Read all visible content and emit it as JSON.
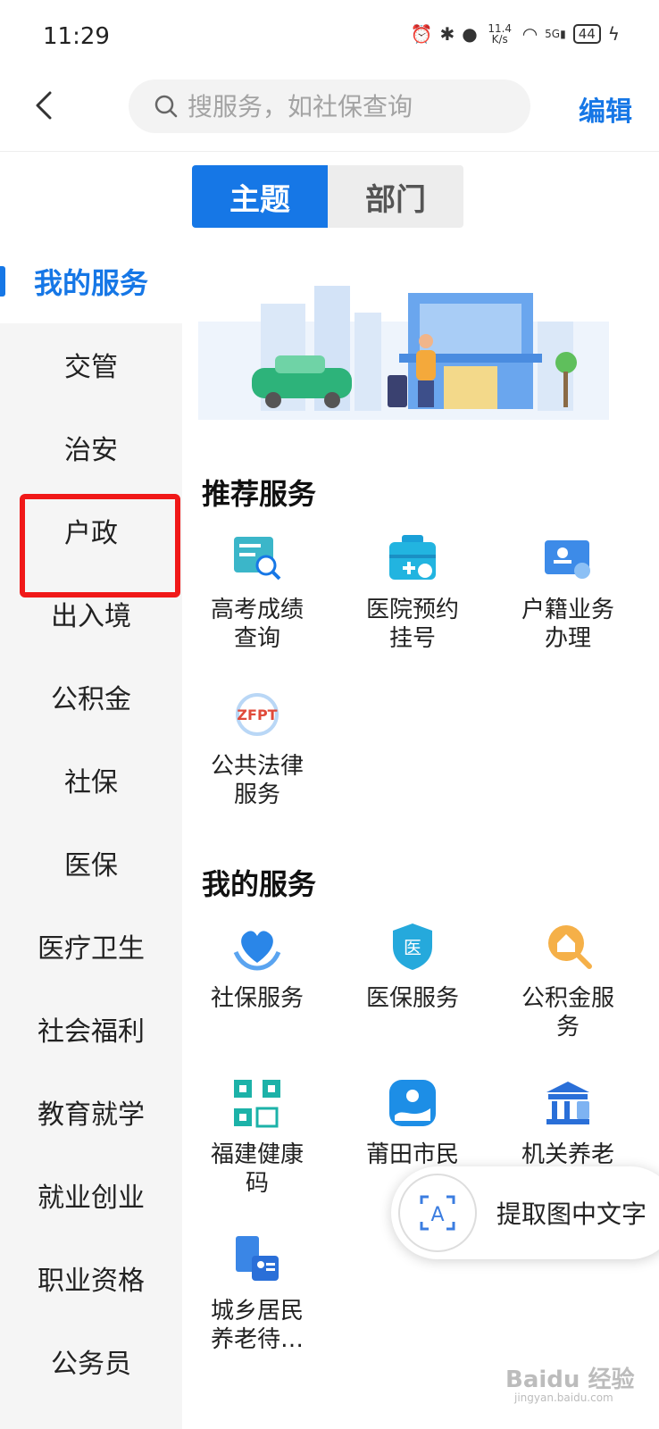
{
  "status_bar": {
    "time": "11:29",
    "net_speed_value": "11.4",
    "net_speed_unit": "K/s",
    "signal_label": "5G",
    "battery": "44"
  },
  "header": {
    "search_placeholder": "搜服务，如社保查询",
    "edit_label": "编辑"
  },
  "tabs": [
    {
      "label": "主题",
      "active": true
    },
    {
      "label": "部门",
      "active": false
    }
  ],
  "sidebar": {
    "items": [
      {
        "label": "我的服务",
        "active": true
      },
      {
        "label": "交管"
      },
      {
        "label": "治安"
      },
      {
        "label": "户政"
      },
      {
        "label": "出入境"
      },
      {
        "label": "公积金"
      },
      {
        "label": "社保"
      },
      {
        "label": "医保"
      },
      {
        "label": "医疗卫生"
      },
      {
        "label": "社会福利"
      },
      {
        "label": "教育就学"
      },
      {
        "label": "就业创业"
      },
      {
        "label": "职业资格"
      },
      {
        "label": "公务员"
      }
    ]
  },
  "recommended": {
    "title": "推荐服务",
    "items": [
      {
        "line1": "高考成绩",
        "line2": "查询",
        "icon": "exam-score-icon"
      },
      {
        "line1": "医院预约",
        "line2": "挂号",
        "icon": "hospital-appointment-icon"
      },
      {
        "line1": "户籍业务",
        "line2": "办理",
        "icon": "household-registration-icon"
      },
      {
        "line1": "公共法律",
        "line2": "服务",
        "icon": "legal-service-icon",
        "icon_text": "ZFPT"
      }
    ]
  },
  "my_services": {
    "title": "我的服务",
    "items": [
      {
        "line1": "社保服务",
        "line2": "",
        "icon": "social-security-icon"
      },
      {
        "line1": "医保服务",
        "line2": "",
        "icon": "medical-insurance-icon",
        "icon_text": "医"
      },
      {
        "line1": "公积金服",
        "line2": "务",
        "icon": "housing-fund-icon"
      },
      {
        "line1": "福建健康",
        "line2": "码",
        "icon": "health-code-icon"
      },
      {
        "line1": "莆田市民",
        "line2": "",
        "icon": "putian-citizen-icon"
      },
      {
        "line1": "机关养老",
        "line2": "",
        "icon": "pension-icon"
      },
      {
        "line1": "城乡居民",
        "line2": "养老待…",
        "icon": "resident-pension-icon"
      }
    ]
  },
  "ocr_button": {
    "label": "提取图中文字",
    "icon_letter": "A"
  },
  "watermark": {
    "text": "Baidu 经验",
    "sub": "jingyan.baidu.com"
  },
  "colors": {
    "accent": "#1677e6",
    "highlight": "#f01818"
  }
}
